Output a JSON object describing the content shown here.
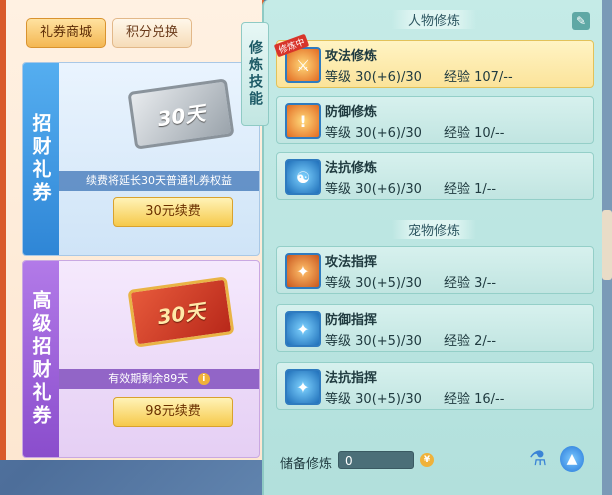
{
  "left": {
    "tabs": [
      "礼券商城",
      "积分兑换"
    ],
    "cards": [
      {
        "side_label": "招财礼券",
        "ticket_text": "30天",
        "strip_text": "续费将延长30天普通礼券权益",
        "button_label": "30元续费"
      },
      {
        "side_label": "高级招财礼券",
        "ticket_text": "30天",
        "strip_text": "有效期剩余89天",
        "info_icon": "i",
        "button_label": "98元续费"
      }
    ]
  },
  "overlay": {
    "vertical_tab": "修炼技能",
    "char_section_title": "人物修炼",
    "pet_section_title": "宠物修炼",
    "level_label": "等级",
    "exp_label": "经验",
    "character_skills": [
      {
        "name": "攻法修炼",
        "level": "30(+6)/30",
        "exp": "107/--",
        "badge": "修炼中",
        "icon": "sword-icon"
      },
      {
        "name": "防御修炼",
        "level": "30(+6)/30",
        "exp": "10/--",
        "icon": "shield-icon"
      },
      {
        "name": "法抗修炼",
        "level": "30(+6)/30",
        "exp": "1/--",
        "icon": "taiji-icon"
      }
    ],
    "pet_skills": [
      {
        "name": "攻法指挥",
        "level": "30(+5)/30",
        "exp": "3/--",
        "icon": "paw-attack-icon"
      },
      {
        "name": "防御指挥",
        "level": "30(+5)/30",
        "exp": "2/--",
        "icon": "paw-shield-icon"
      },
      {
        "name": "法抗指挥",
        "level": "30(+5)/30",
        "exp": "16/--",
        "icon": "paw-magic-icon"
      }
    ],
    "reserve": {
      "label": "储备修炼",
      "value": "0"
    }
  }
}
